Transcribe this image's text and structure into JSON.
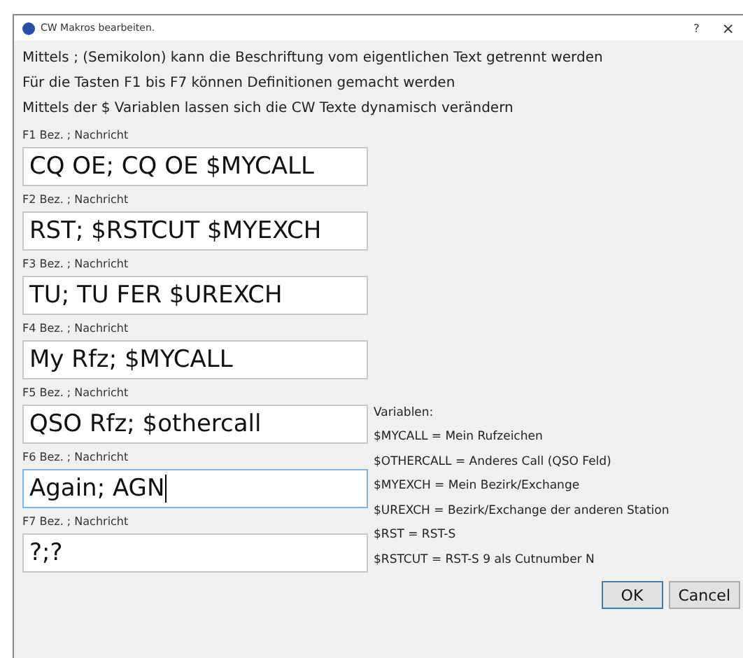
{
  "window": {
    "title": "CW Makros bearbeiten.",
    "help": "?",
    "close": "×"
  },
  "instructions": [
    "Mittels ; (Semikolon) kann die Beschriftung vom eigentlichen Text getrennt werden",
    "Für die Tasten F1 bis F7 können Definitionen gemacht werden",
    "Mittels der $ Variablen lassen sich die CW Texte dynamisch verändern"
  ],
  "macros": [
    {
      "label": "F1 Bez. ; Nachricht",
      "value": "CQ OE; CQ OE $MYCALL",
      "focused": false
    },
    {
      "label": "F2 Bez. ; Nachricht",
      "value": "RST; $RSTCUT $MYEXCH",
      "focused": false
    },
    {
      "label": "F3 Bez. ; Nachricht",
      "value": "TU; TU FER $UREXCH",
      "focused": false
    },
    {
      "label": "F4 Bez. ; Nachricht",
      "value": "My Rfz; $MYCALL",
      "focused": false
    },
    {
      "label": "F5 Bez. ; Nachricht",
      "value": "QSO Rfz; $othercall",
      "focused": false
    },
    {
      "label": "F6 Bez. ; Nachricht",
      "value": "Again; AGN",
      "focused": true
    },
    {
      "label": "F7 Bez. ; Nachricht",
      "value": "?;?",
      "focused": false
    }
  ],
  "variables": [
    "Variablen:",
    "$MYCALL = Mein Rufzeichen",
    "$OTHERCALL = Anderes Call (QSO Feld)",
    "$MYEXCH = Mein Bezirk/Exchange",
    "$UREXCH = Bezirk/Exchange der anderen Station",
    "$RST = RST-S",
    "$RSTCUT = RST-S 9 als Cutnumber N"
  ],
  "buttons": [
    {
      "label": "OK",
      "default": true
    },
    {
      "label": "Cancel",
      "default": false
    }
  ]
}
